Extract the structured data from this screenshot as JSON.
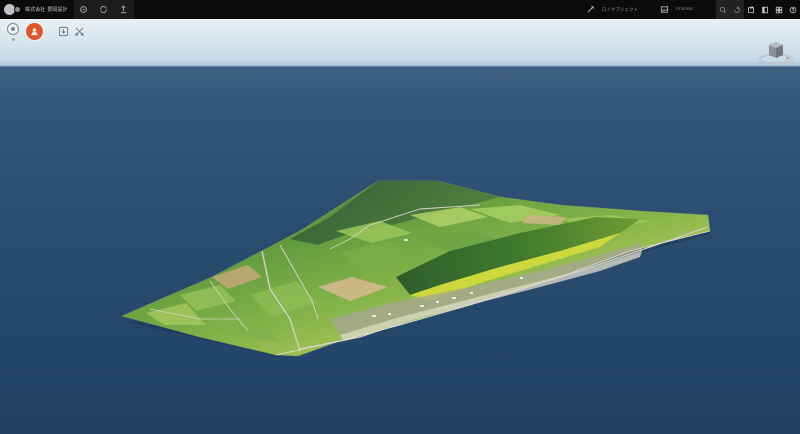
{
  "topbar": {
    "project_name": "株式会社 豊岡設計",
    "left_icons": [
      "settings-icon",
      "sync-icon",
      "upload-icon"
    ],
    "field1_icon": "measure-icon",
    "field1_label": "ロイサブジェクト",
    "field2_icon": "image-icon",
    "field2_label": "Imarker",
    "right_icons": [
      "search-icon",
      "share-icon",
      "export-icon",
      "layers-icon",
      "grid-icon",
      "help-icon"
    ]
  },
  "viewport": {
    "left_tools": [
      "location-pin-icon",
      "user-icon",
      "download-icon",
      "tools-icon"
    ],
    "view_cube": "view-cube-icon",
    "colors": {
      "sky": "#dfeaf2",
      "ocean": "#2b4d6f",
      "accent": "#e2542a"
    }
  }
}
